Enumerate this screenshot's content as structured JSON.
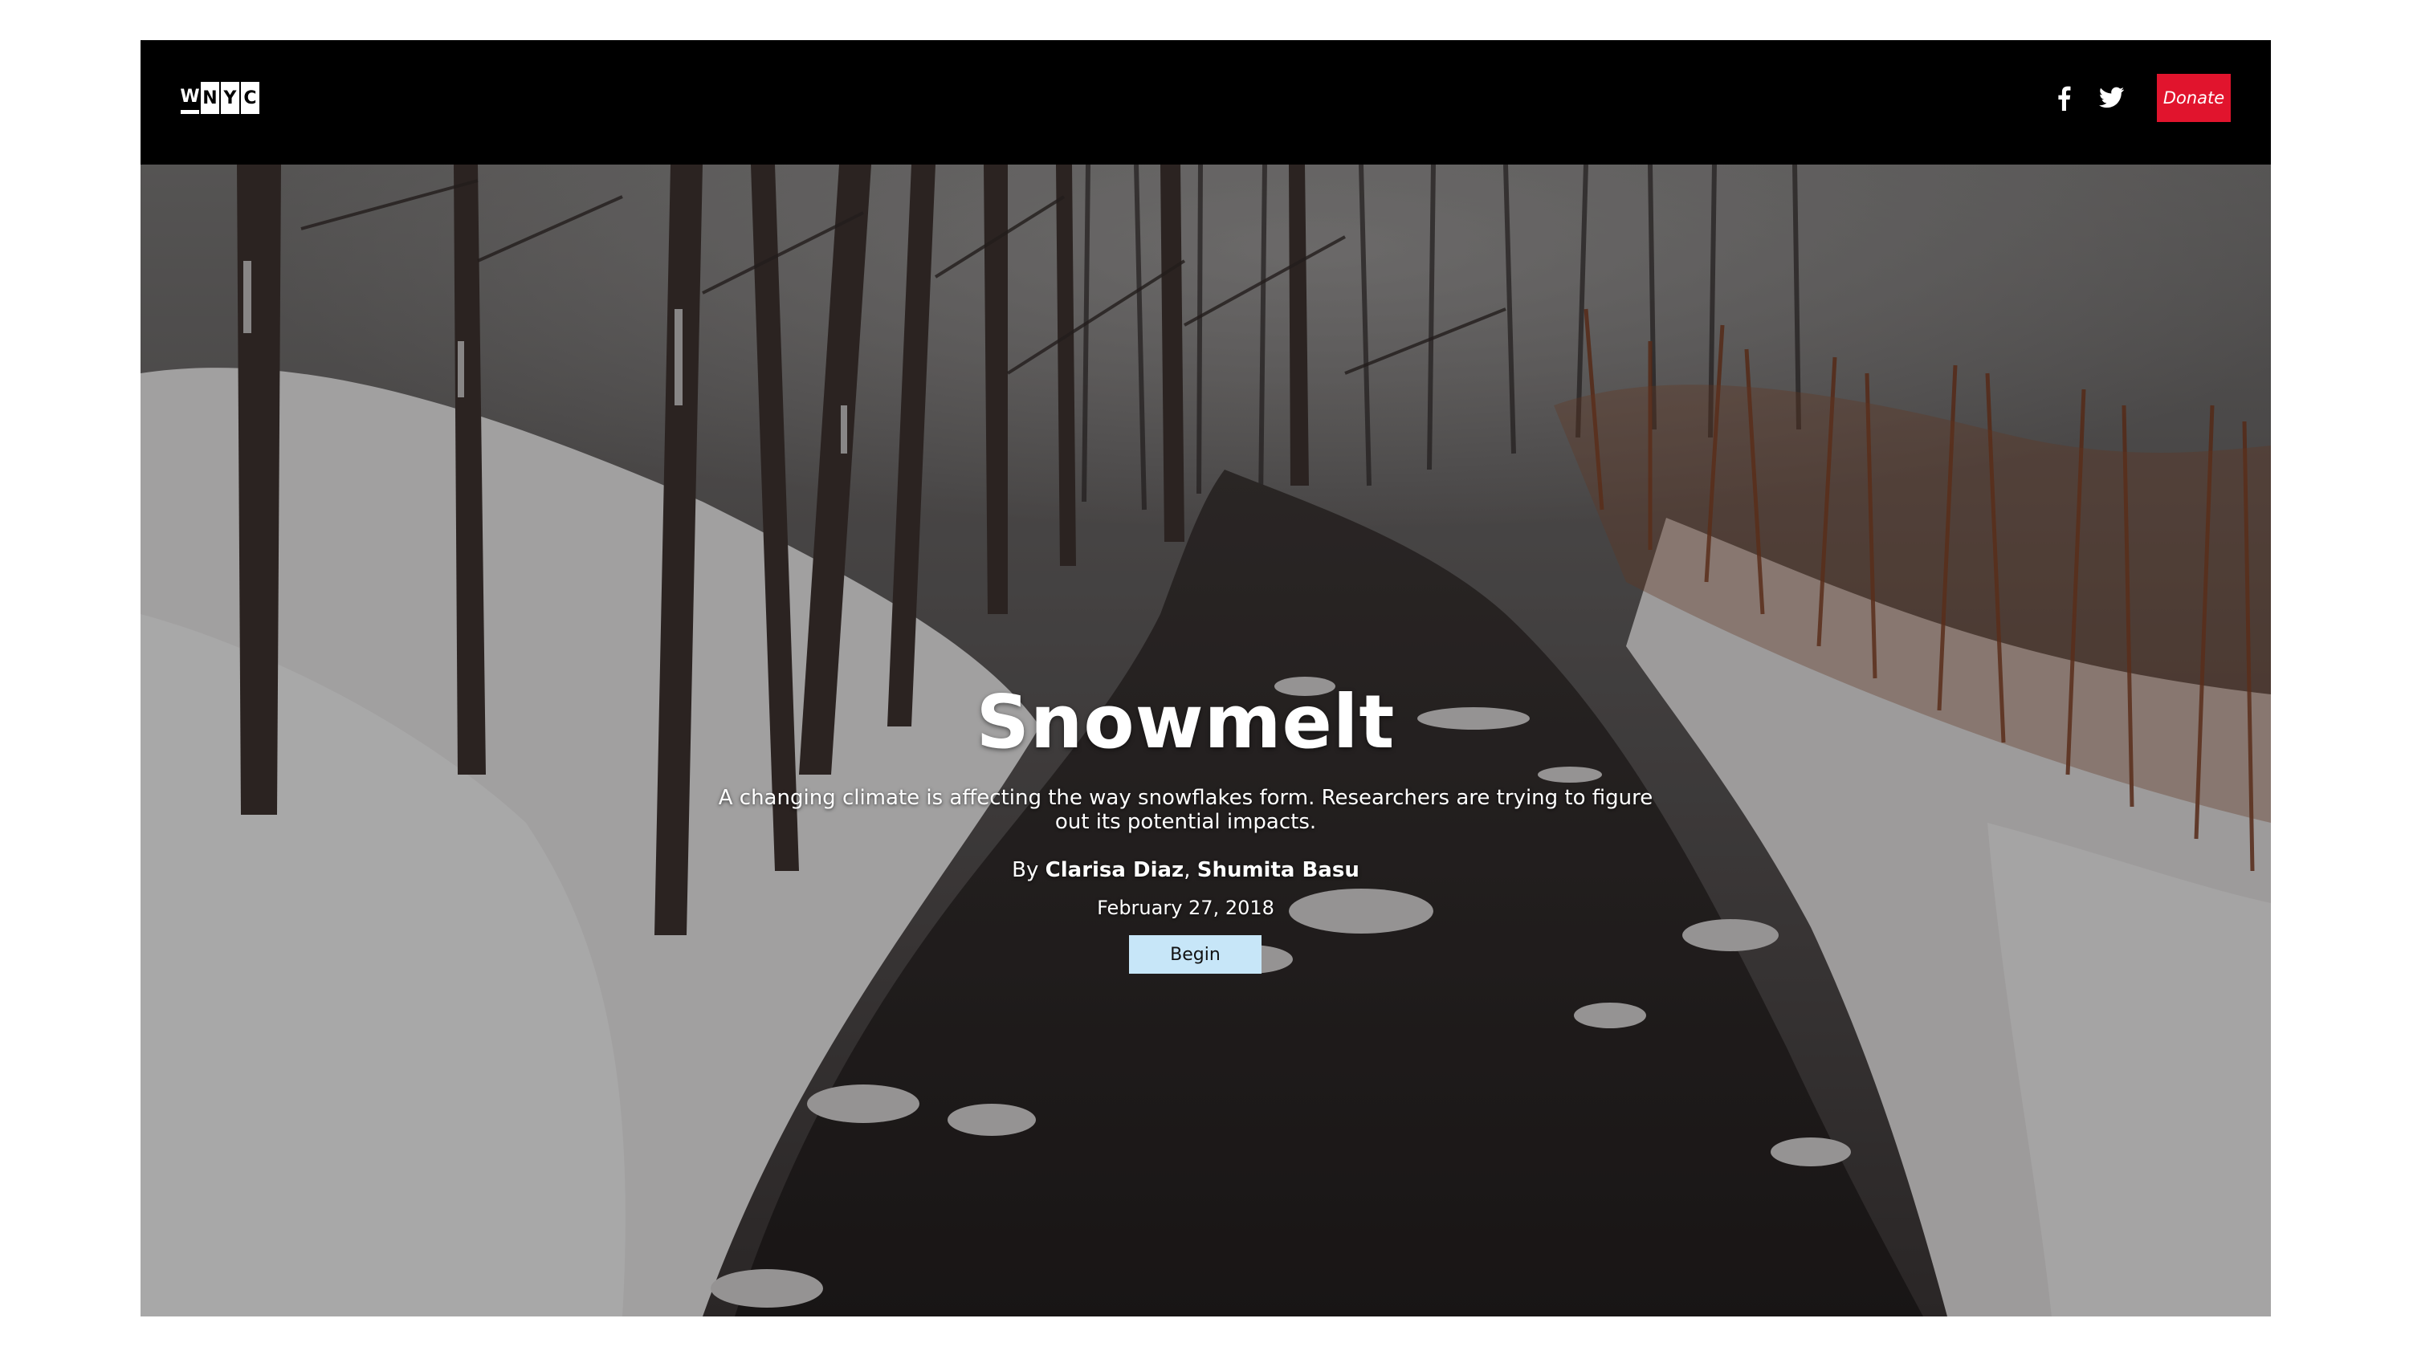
{
  "header": {
    "logo_letters": [
      "W",
      "N",
      "Y",
      "C"
    ],
    "social": [
      {
        "icon": "facebook-icon"
      },
      {
        "icon": "twitter-icon"
      }
    ],
    "donate_label": "Donate",
    "donate_color": "#e1142d"
  },
  "hero": {
    "title": "Snowmelt",
    "subtitle": "A changing climate is affecting the way snowflakes form. Researchers are trying to figure out its potential impacts.",
    "byline_prefix": "By ",
    "authors": [
      "Clarisa Diaz",
      "Shumita Basu"
    ],
    "author_separator": ", ",
    "date": "February 27, 2018",
    "begin_label": "Begin",
    "begin_color": "#c7e6f8"
  }
}
